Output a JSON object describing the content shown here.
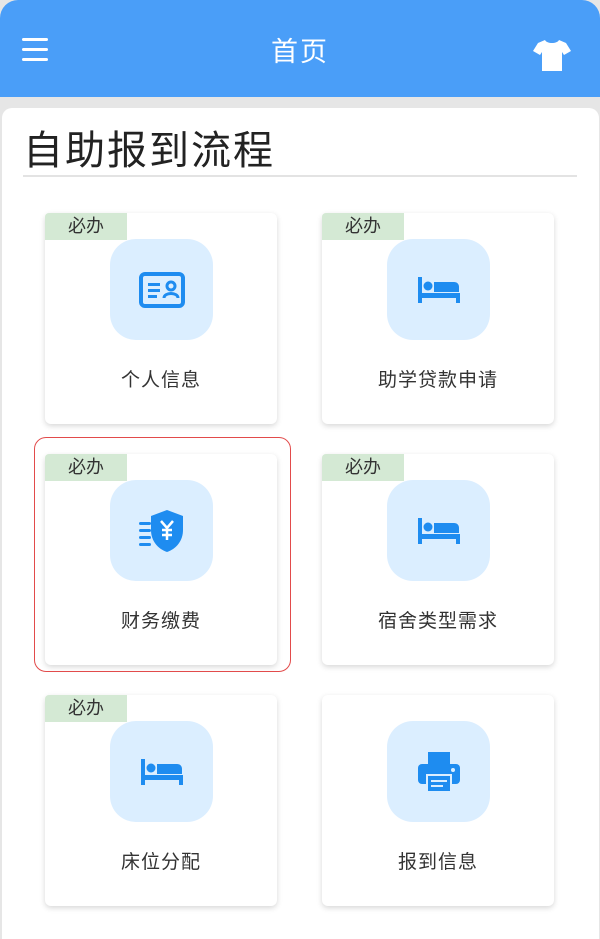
{
  "header": {
    "title": "首页",
    "menu_icon": "hamburger-menu-icon",
    "right_icon": "tshirt-icon",
    "background": "#4a9ef8"
  },
  "section": {
    "title": "自助报到流程"
  },
  "cards": [
    {
      "label": "个人信息",
      "badge": "必办",
      "icon": "id-card-icon"
    },
    {
      "label": "助学贷款申请",
      "badge": "必办",
      "icon": "bed-icon"
    },
    {
      "label": "财务缴费",
      "badge": "必办",
      "icon": "yuan-shield-icon",
      "highlighted": true
    },
    {
      "label": "宿舍类型需求",
      "badge": "必办",
      "icon": "bed-icon"
    },
    {
      "label": "床位分配",
      "badge": "必办",
      "icon": "bed-icon"
    },
    {
      "label": "报到信息",
      "badge": "",
      "icon": "printer-icon"
    }
  ],
  "colors": {
    "accent": "#1e8cf0",
    "icon_background": "#dbeeff",
    "badge_background": "#d4e9d4",
    "highlight_border": "#e24b4b"
  }
}
